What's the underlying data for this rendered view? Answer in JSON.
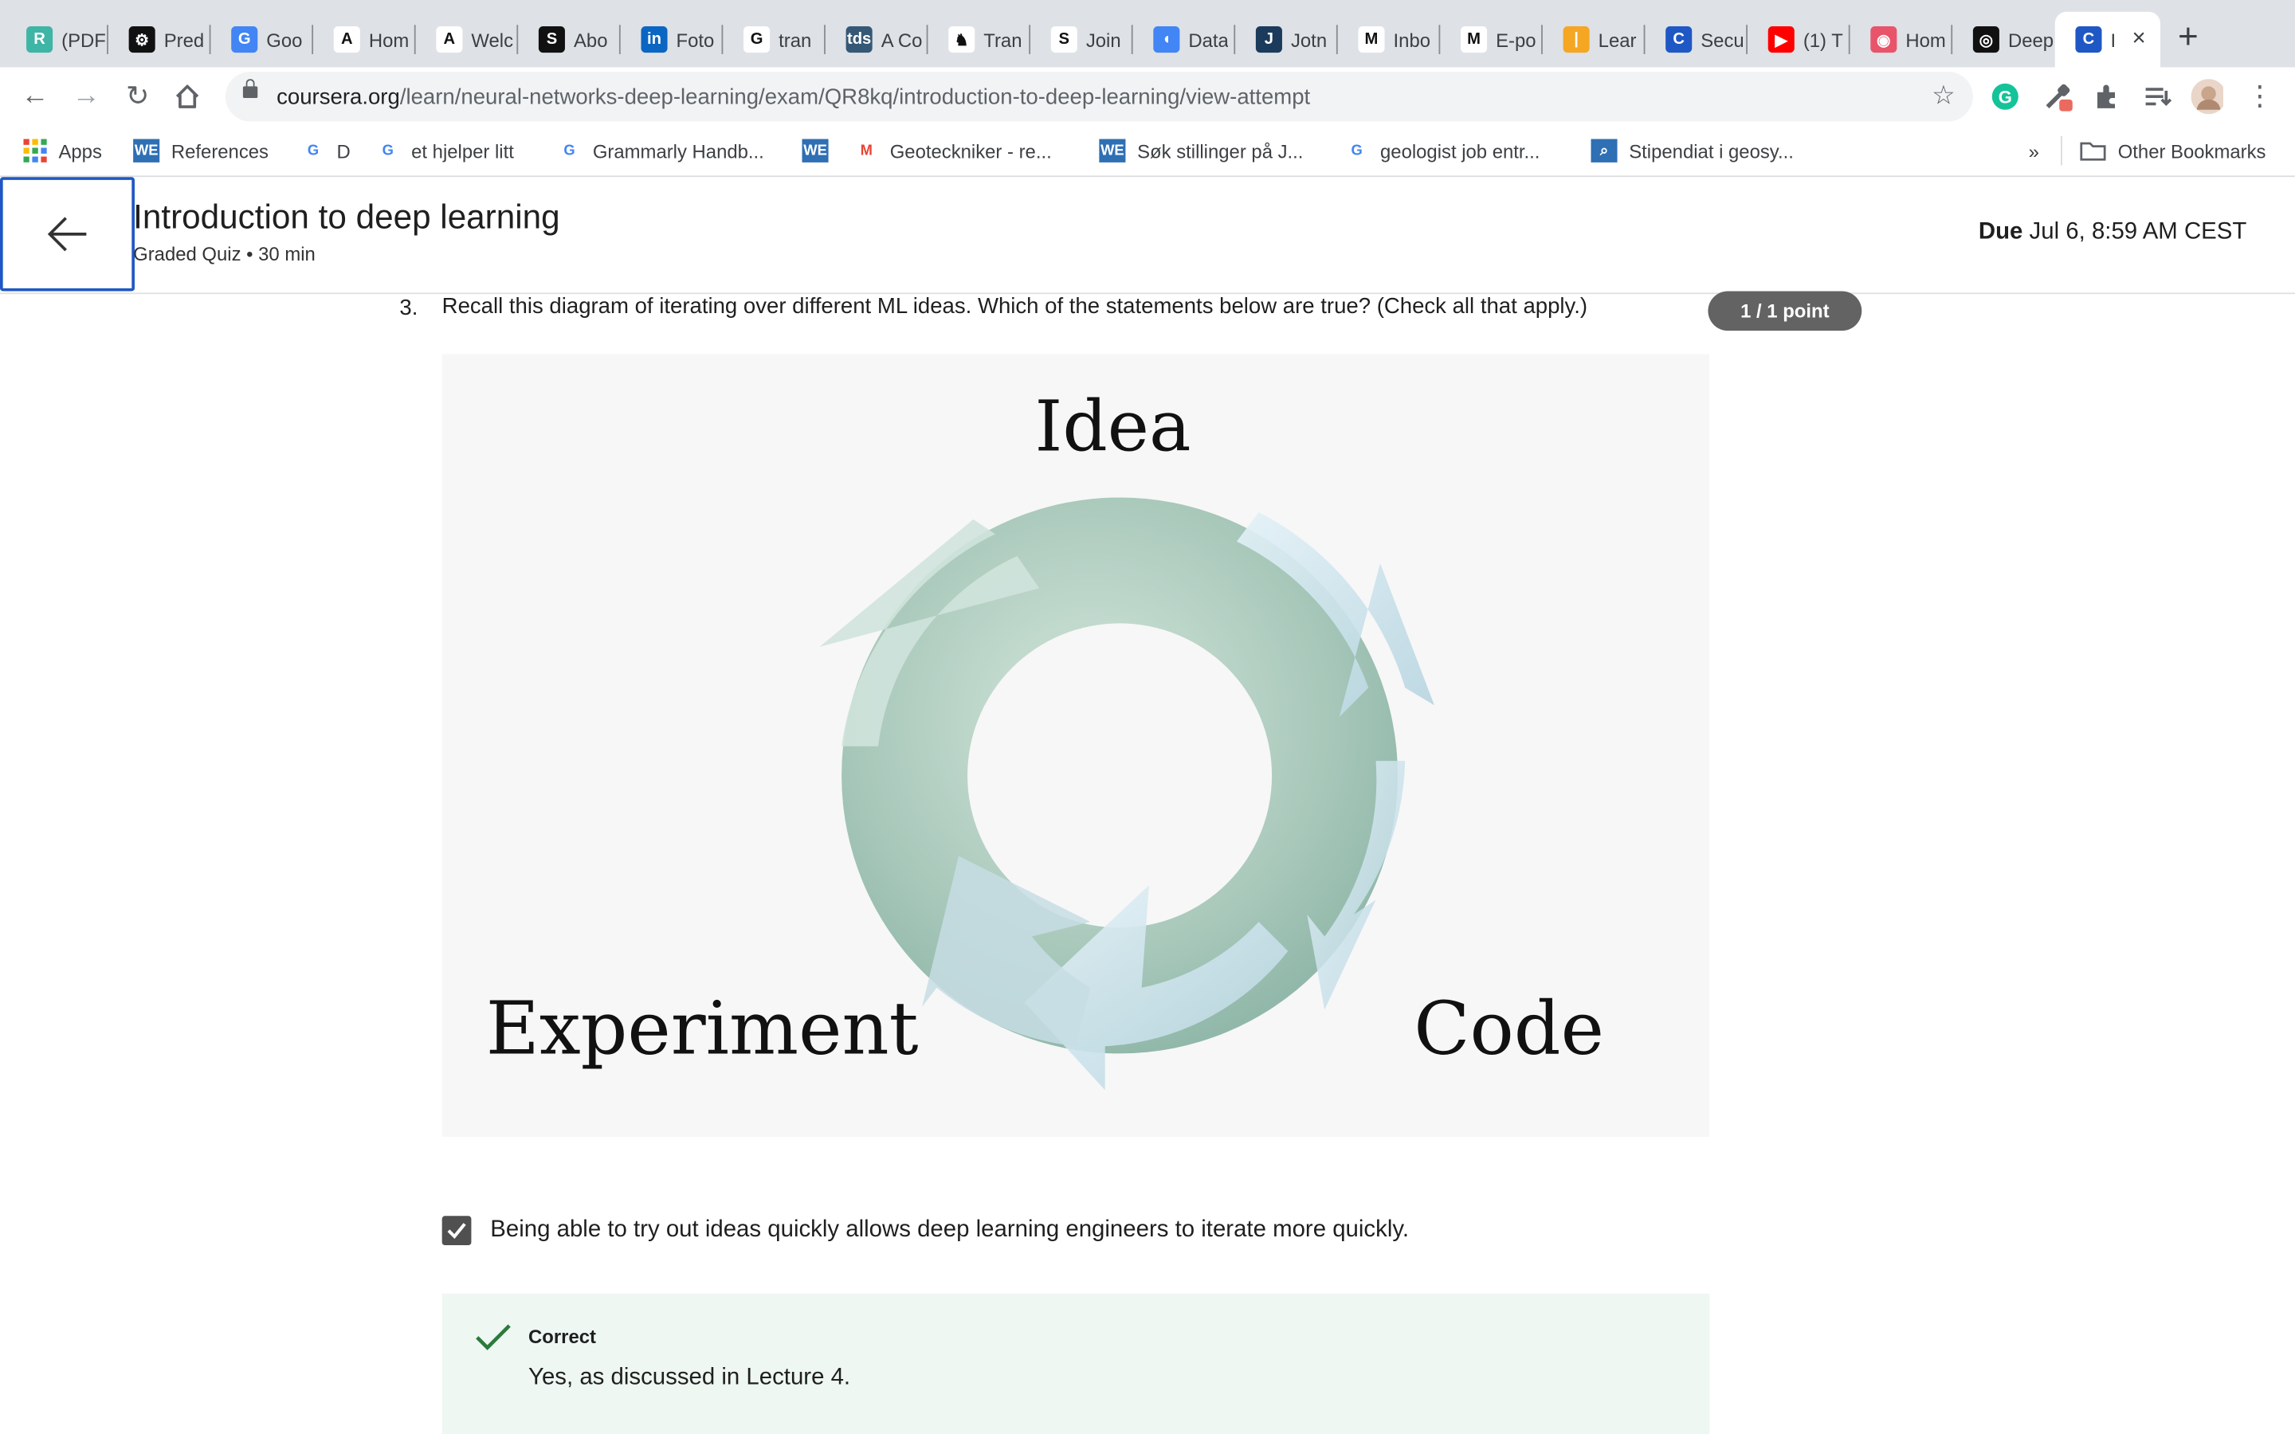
{
  "browser": {
    "tabs": [
      {
        "label": "(PDF",
        "favicon": "R",
        "color": "#3fb5a6"
      },
      {
        "label": "Pred",
        "favicon": "⚙",
        "color": "#111111"
      },
      {
        "label": "Goo",
        "favicon": "G",
        "color": "#4285f4"
      },
      {
        "label": "Hom",
        "favicon": "A",
        "color": "#ffffff"
      },
      {
        "label": "Welc",
        "favicon": "A",
        "color": "#ffffff"
      },
      {
        "label": "Abo",
        "favicon": "S",
        "color": "#111111"
      },
      {
        "label": "Foto",
        "favicon": "in",
        "color": "#0a66c2"
      },
      {
        "label": "tran",
        "favicon": "G",
        "color": "#ffffff"
      },
      {
        "label": "A Co",
        "favicon": "tds",
        "color": "#355876"
      },
      {
        "label": "Tran",
        "favicon": "♞",
        "color": "#ffffff"
      },
      {
        "label": "Join",
        "favicon": "S",
        "color": "#ffffff"
      },
      {
        "label": "Data",
        "favicon": "◖",
        "color": "#4285f4"
      },
      {
        "label": "Jotn",
        "favicon": "J",
        "color": "#1b3a5c"
      },
      {
        "label": "Inbo",
        "favicon": "M",
        "color": "#ffffff"
      },
      {
        "label": "E-po",
        "favicon": "M",
        "color": "#ffffff"
      },
      {
        "label": "Lear",
        "favicon": "|",
        "color": "#f5a623"
      },
      {
        "label": "Secu",
        "favicon": "C",
        "color": "#1f58c4"
      },
      {
        "label": "(1) T",
        "favicon": "▶",
        "color": "#ff0000"
      },
      {
        "label": "Hom",
        "favicon": "◉",
        "color": "#e8546a"
      },
      {
        "label": "Deep",
        "favicon": "◎",
        "color": "#111111"
      },
      {
        "label": "I",
        "favicon": "C",
        "color": "#1f58c4",
        "active": true
      }
    ],
    "url_host": "coursera.org",
    "url_path": "/learn/neural-networks-deep-learning/exam/QR8kq/introduction-to-deep-learning/view-attempt",
    "bookmarks": [
      {
        "label": "Apps",
        "icon": "apps-grid-icon"
      },
      {
        "label": "References",
        "icon": "WE"
      },
      {
        "label": "D",
        "icon": "G"
      },
      {
        "label": "et hjelper litt",
        "icon": "G"
      },
      {
        "label": "Grammarly Handb...",
        "icon": "G"
      },
      {
        "label": "",
        "icon": "WE"
      },
      {
        "label": "Geoteckniker - re...",
        "icon": "M"
      },
      {
        "label": "Søk stillinger på J...",
        "icon": "WE"
      },
      {
        "label": "geologist job entr...",
        "icon": "G"
      },
      {
        "label": "Stipendiat i geosy...",
        "icon": "⌕"
      }
    ],
    "bookmarks_more": "»",
    "other_bookmarks": "Other Bookmarks"
  },
  "header": {
    "title": "Introduction to deep learning",
    "subtitle": "Graded Quiz • 30 min",
    "due_label": "Due",
    "due_value": "Jul 6, 8:59 AM CEST"
  },
  "question": {
    "number": "3.",
    "text": "Recall this diagram of iterating over different ML ideas. Which of the statements below are true? (Check all that apply.)",
    "points": "1 / 1 point",
    "diagram": {
      "idea": "Idea",
      "experiment": "Experiment",
      "code": "Code"
    },
    "option": {
      "text": "Being able to try out ideas quickly allows deep learning engineers to iterate more quickly.",
      "checked": true
    },
    "feedback": {
      "status": "Correct",
      "text": "Yes, as discussed in Lecture 4."
    }
  },
  "colors": {
    "accent": "#1f58c4",
    "correct": "#2b7a3d",
    "feedback_bg": "#eef7f2",
    "badge": "#636363"
  }
}
